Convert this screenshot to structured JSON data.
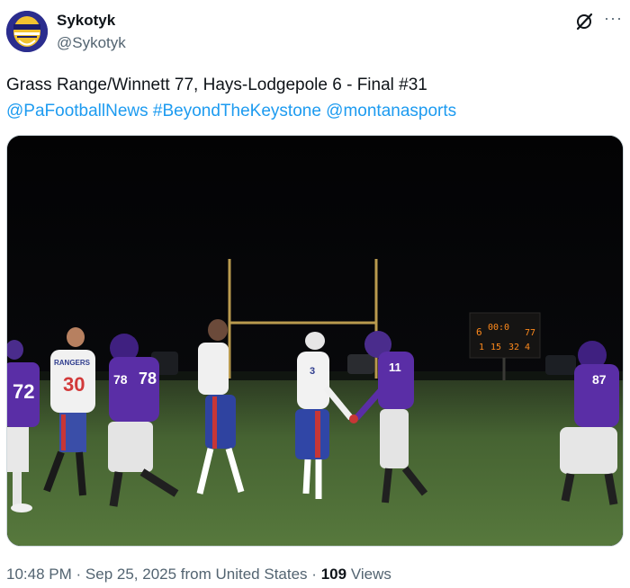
{
  "author": {
    "display_name": "Sykotyk",
    "handle": "@Sykotyk",
    "avatar_icon": "football-helmet-avatar-icon"
  },
  "header_icons": {
    "grok": "grok-slash-icon",
    "more": "···"
  },
  "tweet": {
    "text": "Grass Range/Winnett 77, Hays-Lodgepole 6 - Final #31",
    "tags": [
      {
        "text": "@PaFootballNews"
      },
      {
        "text": "#BeyondTheKeystone"
      },
      {
        "text": "@montanasports"
      }
    ]
  },
  "media": {
    "scoreboard": {
      "home_digit": "6",
      "clock": "00:0",
      "away_score": "77",
      "row2_left": "1",
      "row2_mid": "15",
      "row2_right": "32 4"
    },
    "jersey_numbers": [
      "72",
      "30",
      "78",
      "3",
      "11",
      "87"
    ],
    "jersey_text": "RANGERS"
  },
  "meta": {
    "time": "10:48 PM",
    "separator": "·",
    "date_location": "Sep 25, 2025 from United States",
    "views_count": "109",
    "views_label": "Views"
  },
  "colors": {
    "link": "#1d9bf0",
    "secondary_text": "#536471",
    "purple_jersey": "#5a2ea6",
    "field_green": "#4e6e35"
  }
}
